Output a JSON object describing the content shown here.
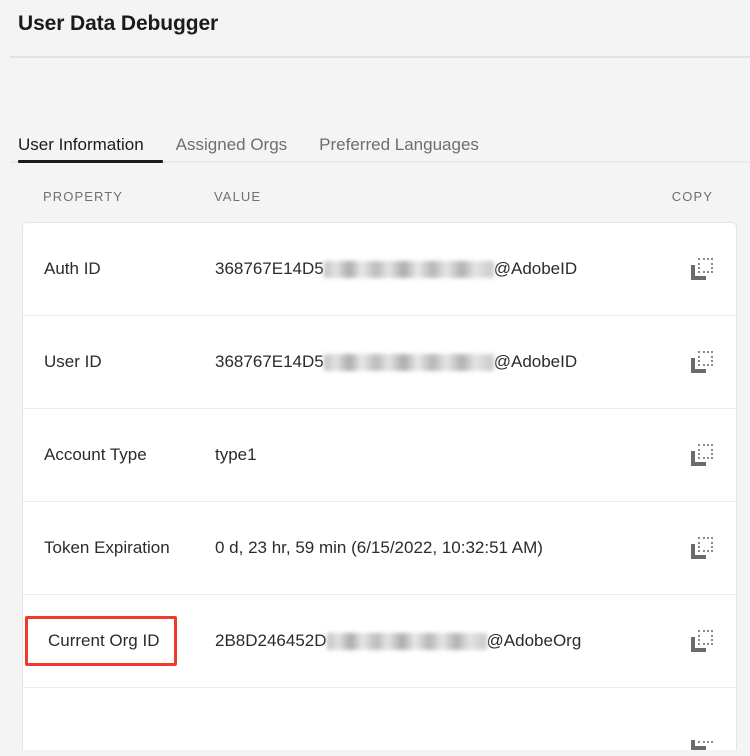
{
  "app": {
    "title": "User Data Debugger"
  },
  "tabs": [
    {
      "label": "User Information",
      "active": true
    },
    {
      "label": "Assigned Orgs",
      "active": false
    },
    {
      "label": "Preferred Languages",
      "active": false
    }
  ],
  "table": {
    "headers": {
      "property": "PROPERTY",
      "value": "VALUE",
      "copy": "COPY"
    },
    "copy_icon": "copy-icon",
    "rows": [
      {
        "property": "Auth ID",
        "value_prefix": "368767E14D5",
        "value_redacted": true,
        "redacted_width": 170,
        "value_suffix": "@AdobeID",
        "highlighted": false
      },
      {
        "property": "User ID",
        "value_prefix": "368767E14D5",
        "value_redacted": true,
        "redacted_width": 170,
        "value_suffix": "@AdobeID",
        "highlighted": false
      },
      {
        "property": "Account Type",
        "value_prefix": "type1",
        "value_redacted": false,
        "redacted_width": 0,
        "value_suffix": "",
        "highlighted": false
      },
      {
        "property": "Token Expiration",
        "value_prefix": "0 d, 23 hr, 59 min (6/15/2022, 10:32:51 AM)",
        "value_redacted": false,
        "redacted_width": 0,
        "value_suffix": "",
        "highlighted": false
      },
      {
        "property": "Current Org ID",
        "value_prefix": "2B8D246452D",
        "value_redacted": true,
        "redacted_width": 160,
        "value_suffix": "@AdobeOrg",
        "highlighted": true
      }
    ],
    "partial_row": {
      "property": "",
      "value_prefix": "",
      "value_redacted": false,
      "redacted_width": 0,
      "value_suffix": "",
      "highlighted": false
    }
  },
  "colors": {
    "page_background": "#f4f4f4",
    "card_background": "#ffffff",
    "text_primary": "#2b2b2b",
    "text_muted": "#6e6e6e",
    "header_muted": "#707070",
    "divider": "#ececec",
    "highlight_red": "#ee3b2b",
    "active_tab_underline": "#1b1b1b",
    "copy_icon_gray": "#6b6b6b"
  }
}
